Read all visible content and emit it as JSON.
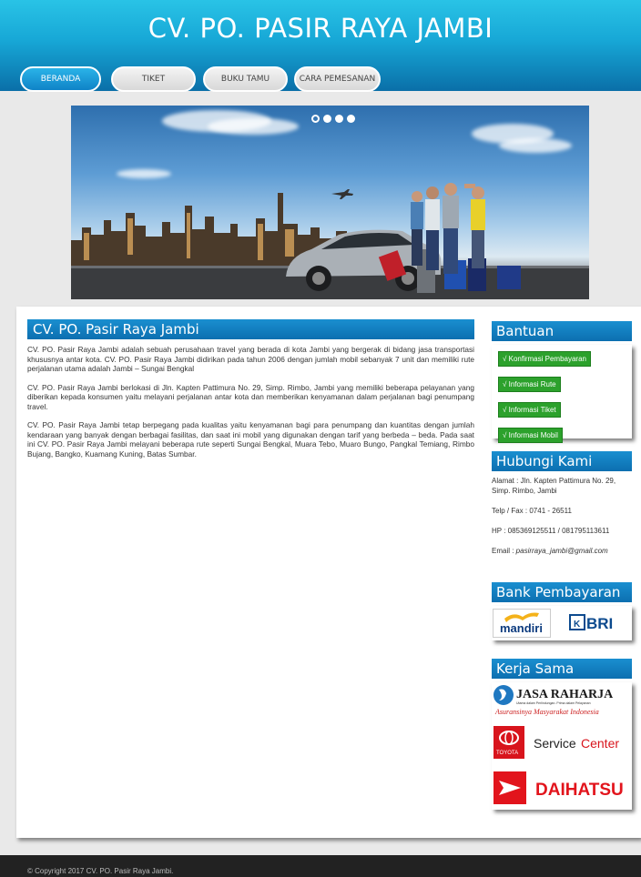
{
  "site": {
    "title": "CV. PO. PASIR RAYA JAMBI"
  },
  "nav": [
    "BERANDA",
    "TIKET",
    "BUKU TAMU",
    "CARA PEMESANAN"
  ],
  "main": {
    "heading": "CV. PO. Pasir Raya Jambi",
    "paragraphs": [
      "CV. PO. Pasir Raya Jambi adalah sebuah perusahaan travel yang berada di kota Jambi yang bergerak di bidang jasa transportasi khususnya antar kota. CV. PO. Pasir Raya Jambi didirikan pada tahun 2006 dengan jumlah mobil sebanyak 7 unit dan memiliki rute perjalanan utama adalah Jambi – Sungai Bengkal",
      "CV. PO. Pasir Raya Jambi berlokasi di Jln. Kapten Pattimura No. 29, Simp. Rimbo, Jambi yang memiliki beberapa pelayanan yang diberikan kepada konsumen yaitu melayani perjalanan antar kota dan memberikan kenyamanan dalam perjalanan bagi penumpang travel.",
      "CV. PO. Pasir Raya Jambi tetap berpegang pada kualitas yaitu kenyamanan bagi para penumpang dan kuantitas dengan jumlah kendaraan yang banyak dengan berbagai fasilitas, dan saat ini mobil yang digunakan dengan tarif yang berbeda – beda. Pada saat ini CV. PO. Pasir Raya Jambi melayani beberapa rute seperti Sungai Bengkal, Muara Tebo, Muaro Bungo, Pangkal Temiang, Rimbo Bujang, Bangko, Kuamang Kuning, Batas Sumbar."
    ]
  },
  "bantuan": {
    "title": "Bantuan",
    "items": [
      "√ Konfirmasi Pembayaran",
      "√ Informasi Rute",
      "√ Informasi Tiket",
      "√ Informasi Mobil"
    ]
  },
  "contact": {
    "title": "Hubungi Kami",
    "alamat": "Alamat : Jln. Kapten Pattimura No. 29, Simp. Rimbo, Jambi",
    "telp": "Telp / Fax : 0741 - 26511",
    "hp": "HP : 085369125511 / 081795113611",
    "email_label": "Email : ",
    "email": "pasirraya_jambi@gmail.com"
  },
  "bank": {
    "title": "Bank Pembayaran",
    "logos": [
      "mandiri",
      "BRI"
    ]
  },
  "kerjasama": {
    "title": "Kerja Sama",
    "jasa_name": "JASA RAHARJA",
    "jasa_sub": "Utama dalam Perlindungan. Prima dalam Pelayanan",
    "jasa_tagline": "Asuransinya Masyarakat Indonesia",
    "toyota": "TOYOTA",
    "service_a": "Service",
    "service_b": "Center",
    "daihatsu": "DAIHATSU"
  },
  "footer": "© Copyright 2017 CV. PO. Pasir Raya Jambi.",
  "colors": {
    "header": "#17a7d6",
    "section_head": "#0c6fb0",
    "help_button": "#2ca12c",
    "footer": "#222222"
  }
}
